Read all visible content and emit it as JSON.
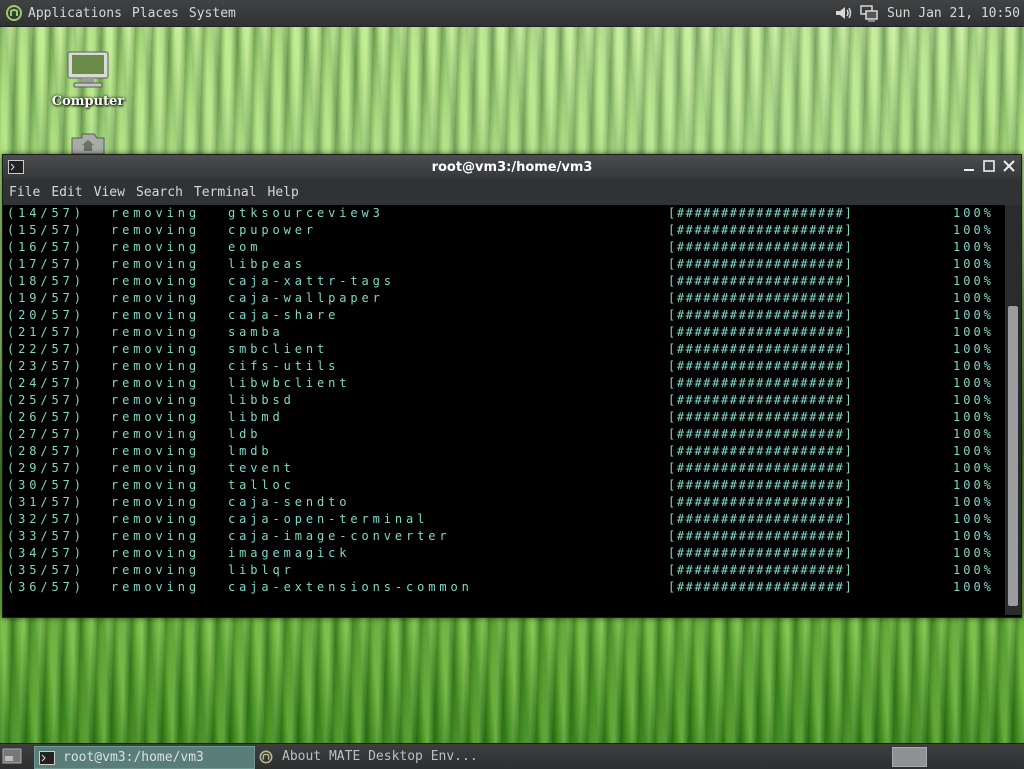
{
  "top_panel": {
    "menus": [
      "Applications",
      "Places",
      "System"
    ],
    "clock": "Sun Jan 21, 10:50",
    "tray_icons": [
      "volume-icon",
      "network-icon"
    ]
  },
  "desktop": {
    "icons": [
      {
        "label": "Computer",
        "icon": "computer-icon"
      },
      {
        "label": "",
        "icon": "home-folder-icon"
      }
    ]
  },
  "terminal": {
    "title": "root@vm3:/home/vm3",
    "menu": [
      "File",
      "Edit",
      "View",
      "Search",
      "Terminal",
      "Help"
    ],
    "lines": [
      {
        "num": "(14/57)",
        "action": "removing",
        "pkg": "gtksourceview3",
        "bar": "[###################]",
        "pct": "100%"
      },
      {
        "num": "(15/57)",
        "action": "removing",
        "pkg": "cpupower",
        "bar": "[###################]",
        "pct": "100%"
      },
      {
        "num": "(16/57)",
        "action": "removing",
        "pkg": "eom",
        "bar": "[###################]",
        "pct": "100%"
      },
      {
        "num": "(17/57)",
        "action": "removing",
        "pkg": "libpeas",
        "bar": "[###################]",
        "pct": "100%"
      },
      {
        "num": "(18/57)",
        "action": "removing",
        "pkg": "caja-xattr-tags",
        "bar": "[###################]",
        "pct": "100%"
      },
      {
        "num": "(19/57)",
        "action": "removing",
        "pkg": "caja-wallpaper",
        "bar": "[###################]",
        "pct": "100%"
      },
      {
        "num": "(20/57)",
        "action": "removing",
        "pkg": "caja-share",
        "bar": "[###################]",
        "pct": "100%"
      },
      {
        "num": "(21/57)",
        "action": "removing",
        "pkg": "samba",
        "bar": "[###################]",
        "pct": "100%"
      },
      {
        "num": "(22/57)",
        "action": "removing",
        "pkg": "smbclient",
        "bar": "[###################]",
        "pct": "100%"
      },
      {
        "num": "(23/57)",
        "action": "removing",
        "pkg": "cifs-utils",
        "bar": "[###################]",
        "pct": "100%"
      },
      {
        "num": "(24/57)",
        "action": "removing",
        "pkg": "libwbclient",
        "bar": "[###################]",
        "pct": "100%"
      },
      {
        "num": "(25/57)",
        "action": "removing",
        "pkg": "libbsd",
        "bar": "[###################]",
        "pct": "100%"
      },
      {
        "num": "(26/57)",
        "action": "removing",
        "pkg": "libmd",
        "bar": "[###################]",
        "pct": "100%"
      },
      {
        "num": "(27/57)",
        "action": "removing",
        "pkg": "ldb",
        "bar": "[###################]",
        "pct": "100%"
      },
      {
        "num": "(28/57)",
        "action": "removing",
        "pkg": "lmdb",
        "bar": "[###################]",
        "pct": "100%"
      },
      {
        "num": "(29/57)",
        "action": "removing",
        "pkg": "tevent",
        "bar": "[###################]",
        "pct": "100%"
      },
      {
        "num": "(30/57)",
        "action": "removing",
        "pkg": "talloc",
        "bar": "[###################]",
        "pct": "100%"
      },
      {
        "num": "(31/57)",
        "action": "removing",
        "pkg": "caja-sendto",
        "bar": "[###################]",
        "pct": "100%"
      },
      {
        "num": "(32/57)",
        "action": "removing",
        "pkg": "caja-open-terminal",
        "bar": "[###################]",
        "pct": "100%"
      },
      {
        "num": "(33/57)",
        "action": "removing",
        "pkg": "caja-image-converter",
        "bar": "[###################]",
        "pct": "100%"
      },
      {
        "num": "(34/57)",
        "action": "removing",
        "pkg": "imagemagick",
        "bar": "[###################]",
        "pct": "100%"
      },
      {
        "num": "(35/57)",
        "action": "removing",
        "pkg": "liblqr",
        "bar": "[###################]",
        "pct": "100%"
      },
      {
        "num": "(36/57)",
        "action": "removing",
        "pkg": "caja-extensions-common",
        "bar": "[###################]",
        "pct": "100%"
      }
    ],
    "scroll_position": 0.95
  },
  "taskbar": {
    "tasks": [
      {
        "label": "root@vm3:/home/vm3",
        "active": true,
        "icon": "terminal-icon"
      },
      {
        "label": "About MATE Desktop Env...",
        "active": false,
        "icon": "mate-logo-icon"
      }
    ]
  }
}
